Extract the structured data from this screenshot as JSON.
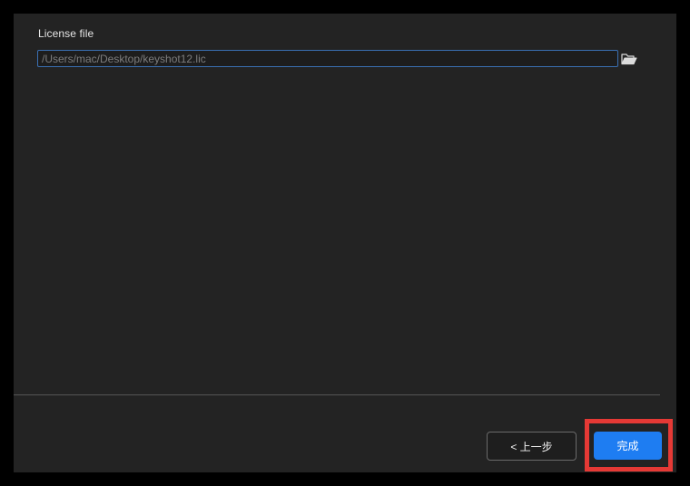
{
  "dialog": {
    "license_label": "License file",
    "license_path": "/Users/mac/Desktop/keyshot12.lic",
    "browse_icon": "folder-open-icon"
  },
  "footer": {
    "back_label": "< 上一步",
    "finish_label": "完成"
  },
  "colors": {
    "background": "#232323",
    "accent": "#1e7df2",
    "highlight": "#e53935"
  }
}
